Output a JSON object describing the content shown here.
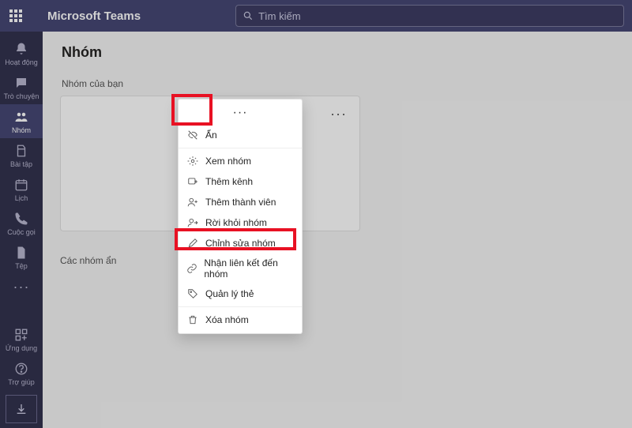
{
  "app": {
    "title": "Microsoft Teams"
  },
  "search": {
    "placeholder": "Tìm kiếm"
  },
  "rail": {
    "activity": "Hoạt động",
    "chat": "Trò chuyện",
    "teams": "Nhóm",
    "assignments": "Bài tập",
    "calendar": "Lịch",
    "calls": "Cuộc gọi",
    "files": "Tệp",
    "apps": "Ứng dụng",
    "help": "Trợ giúp"
  },
  "page": {
    "title": "Nhóm",
    "your_teams": "Nhóm của bạn",
    "hidden_teams": "Các nhóm ẩn"
  },
  "menu": {
    "hide": "Ẩn",
    "view_team": "Xem nhóm",
    "add_channel": "Thêm kênh",
    "add_member": "Thêm thành viên",
    "leave_team": "Rời khỏi nhóm",
    "edit_team": "Chỉnh sửa nhóm",
    "get_link": "Nhận liên kết đến nhóm",
    "manage_tags": "Quản lý thẻ",
    "delete_team": "Xóa nhóm"
  }
}
